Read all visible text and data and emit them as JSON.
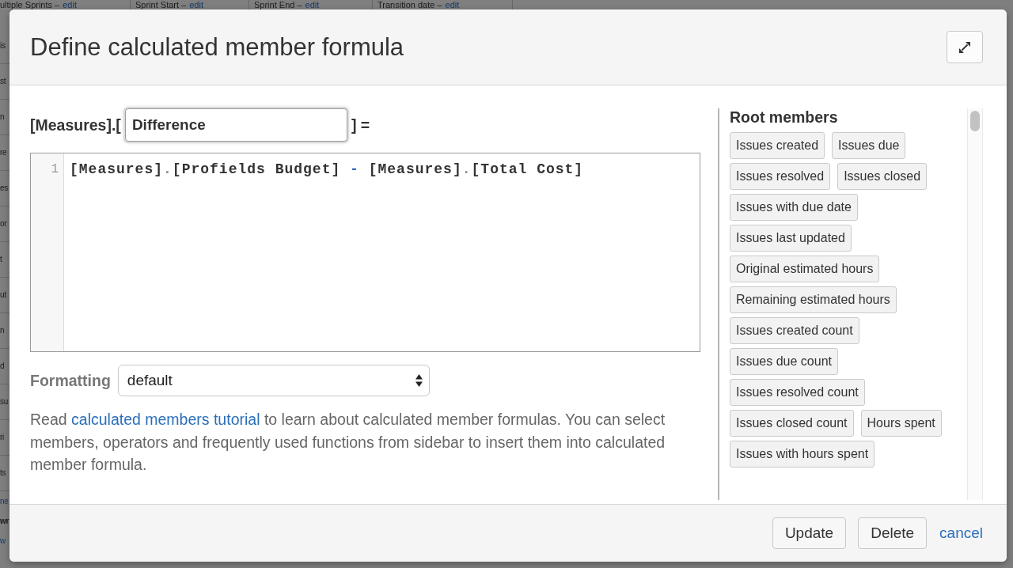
{
  "background_page": {
    "table_headers": [
      {
        "label": "ultiple Sprints –",
        "link": "edit"
      },
      {
        "label": "Sprint Start –",
        "link": "edit"
      },
      {
        "label": "Sprint End –",
        "link": "edit"
      },
      {
        "label": "Transition date –",
        "link": "edit"
      }
    ],
    "row_fragments": [
      {
        "text": "is",
        "kind": "text"
      },
      {
        "text": "st",
        "kind": "text"
      },
      {
        "text": "n",
        "kind": "text"
      },
      {
        "text": "re",
        "kind": "text"
      },
      {
        "text": "es",
        "kind": "text"
      },
      {
        "text": "or",
        "kind": "text"
      },
      {
        "text": "t",
        "kind": "text"
      },
      {
        "text": "ut",
        "kind": "text"
      },
      {
        "text": "n",
        "kind": "text"
      },
      {
        "text": "d",
        "kind": "text"
      },
      {
        "text": "su",
        "kind": "text"
      },
      {
        "text": "ri",
        "kind": "text"
      },
      {
        "text": "ts",
        "kind": "text"
      },
      {
        "text": "ne",
        "kind": "link"
      },
      {
        "text": "wr",
        "kind": "bold"
      },
      {
        "text": "w",
        "kind": "link"
      }
    ]
  },
  "dialog": {
    "title": "Define calculated member formula",
    "name_row": {
      "prefix": "[Measures].[",
      "value": "Difference",
      "suffix": "] ="
    },
    "editor": {
      "lines": [
        {
          "number": "1",
          "tokens": [
            {
              "text": "[Measures]",
              "kind": "member"
            },
            {
              "text": ".",
              "kind": "punct"
            },
            {
              "text": "[Profields Budget]",
              "kind": "member"
            },
            {
              "text": " - ",
              "kind": "operator"
            },
            {
              "text": "[Measures]",
              "kind": "member"
            },
            {
              "text": ".",
              "kind": "punct"
            },
            {
              "text": "[Total Cost]",
              "kind": "member"
            }
          ]
        }
      ]
    },
    "formatting": {
      "label": "Formatting",
      "value": "default"
    },
    "help": {
      "before": "Read ",
      "link": "calculated members tutorial",
      "after": " to learn about calculated member formulas. You can select members, operators and frequently used functions from sidebar to insert them into calculated member formula."
    },
    "sidebar": {
      "title": "Root members",
      "members": [
        "Issues created",
        "Issues due",
        "Issues resolved",
        "Issues closed",
        "Issues with due date",
        "Issues last updated",
        "Original estimated hours",
        "Remaining estimated hours",
        "Issues created count",
        "Issues due count",
        "Issues resolved count",
        "Issues closed count",
        "Hours spent",
        "Issues with hours spent"
      ]
    },
    "buttons": [
      {
        "label": "Update",
        "kind": "button"
      },
      {
        "label": "Delete",
        "kind": "button"
      },
      {
        "label": "cancel",
        "kind": "link"
      }
    ]
  }
}
